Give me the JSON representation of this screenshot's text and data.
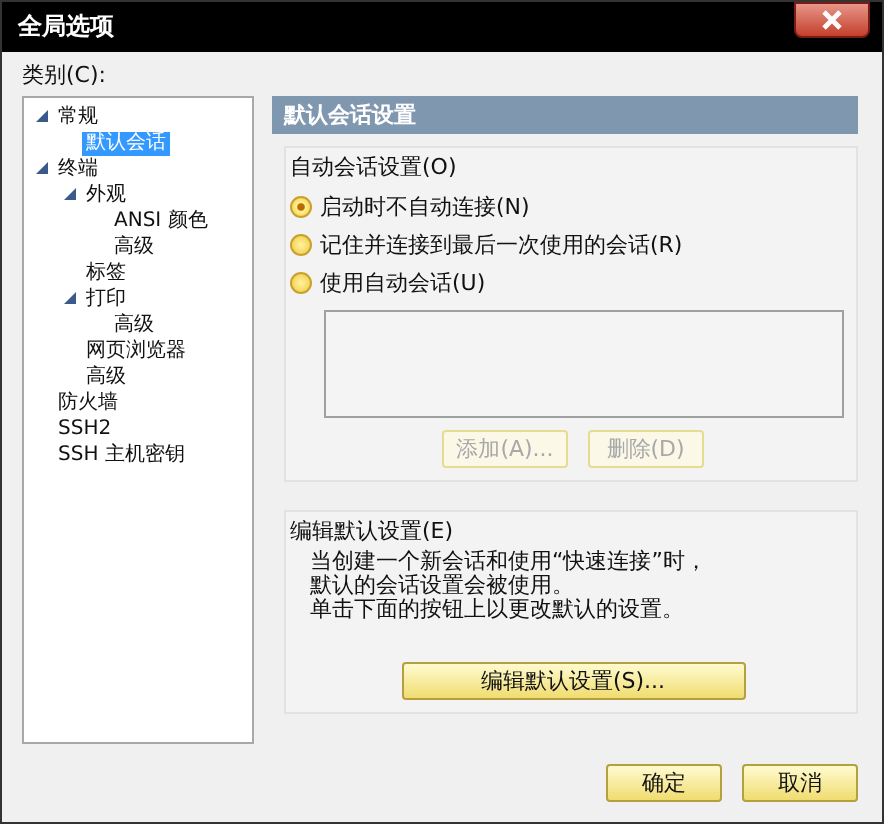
{
  "window": {
    "title": "全局选项"
  },
  "category_label": "类别(C):",
  "tree": [
    {
      "label": "常规",
      "expanded": true,
      "selected": false,
      "children": [
        {
          "label": "默认会话",
          "selected": true
        }
      ]
    },
    {
      "label": "终端",
      "expanded": true,
      "selected": false,
      "children": [
        {
          "label": "外观",
          "expanded": true,
          "selected": false,
          "children": [
            {
              "label": "ANSI 颜色",
              "selected": false
            },
            {
              "label": "高级",
              "selected": false
            }
          ]
        },
        {
          "label": "标签",
          "selected": false
        },
        {
          "label": "打印",
          "expanded": true,
          "selected": false,
          "children": [
            {
              "label": "高级",
              "selected": false
            }
          ]
        },
        {
          "label": "网页浏览器",
          "selected": false
        },
        {
          "label": "高级",
          "selected": false
        }
      ]
    },
    {
      "label": "防火墙",
      "selected": false
    },
    {
      "label": "SSH2",
      "selected": false
    },
    {
      "label": "SSH 主机密钥",
      "selected": false
    }
  ],
  "panel_title": "默认会话设置",
  "auto_session": {
    "label": "自动会话设置(O)",
    "options": [
      {
        "label": "启动时不自动连接(N)",
        "selected": true
      },
      {
        "label": "记住并连接到最后一次使用的会话(R)",
        "selected": false
      },
      {
        "label": "使用自动会话(U)",
        "selected": false
      }
    ],
    "buttons": [
      {
        "label": "添加(A)...",
        "disabled": true
      },
      {
        "label": "删除(D)",
        "disabled": true
      }
    ]
  },
  "default_settings": {
    "label": "编辑默认设置(E)",
    "lines": [
      "当创建一个新会话和使用“快速连接”时，",
      "默认的会话设置会被使用。",
      "单击下面的按钮上以更改默认的设置。"
    ],
    "button": "编辑默认设置(S)..."
  },
  "buttons": [
    {
      "label": "确定",
      "disabled": false
    },
    {
      "label": "取消",
      "disabled": false
    }
  ]
}
